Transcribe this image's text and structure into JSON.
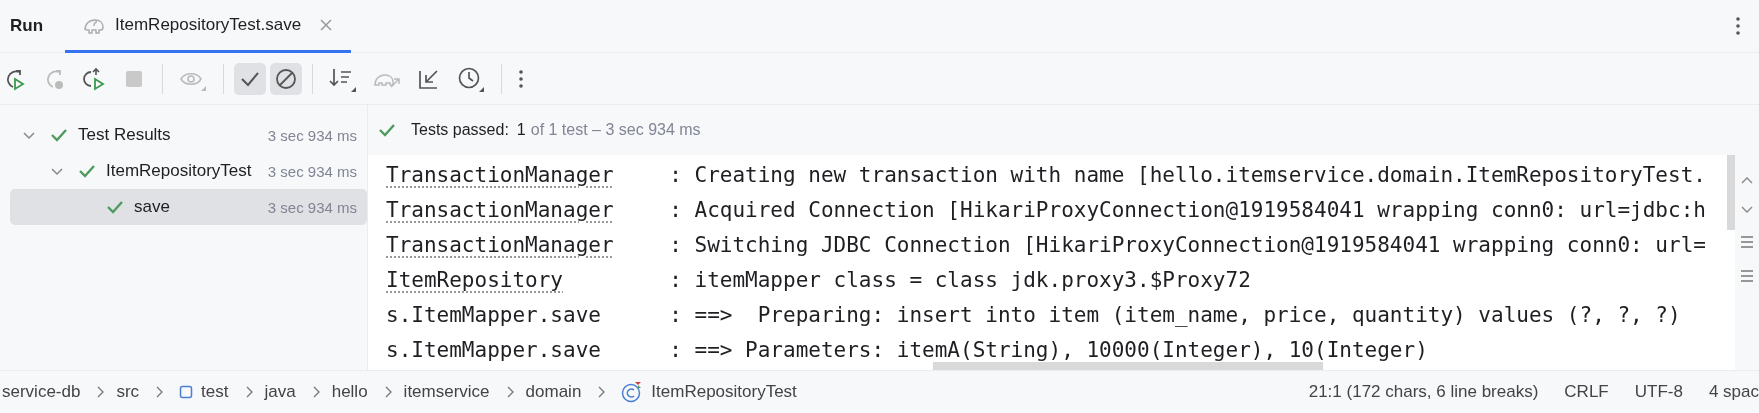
{
  "run_panel": {
    "title": "Run",
    "tabs": [
      {
        "label": "ItemRepositoryTest.save",
        "selected": true
      }
    ]
  },
  "toolbar": {
    "toggles": [
      {
        "selected": true
      },
      {
        "selected": true
      }
    ]
  },
  "test_tree": [
    {
      "label": "Test Results",
      "time": "3 sec 934 ms",
      "passed": true,
      "expanded": true,
      "selected": false,
      "children": [
        {
          "label": "ItemRepositoryTest",
          "time": "3 sec 934 ms",
          "passed": true,
          "expanded": true,
          "selected": false,
          "children": [
            {
              "label": "save",
              "time": "3 sec 934 ms",
              "passed": true,
              "selected": true
            }
          ]
        }
      ]
    }
  ],
  "summary": {
    "passed": true,
    "status": "Tests passed:",
    "count": "1",
    "detail": "of 1 test – 3 sec 934 ms"
  },
  "console": [
    {
      "logger": "TransactionManager",
      "linked": true,
      "message": ": Creating new transaction with name [hello.itemservice.domain.ItemRepositoryTest."
    },
    {
      "logger": "TransactionManager",
      "linked": true,
      "message": ": Acquired Connection [HikariProxyConnection@1919584041 wrapping conn0: url=jdbc:h"
    },
    {
      "logger": "TransactionManager",
      "linked": true,
      "message": ": Switching JDBC Connection [HikariProxyConnection@1919584041 wrapping conn0: url="
    },
    {
      "logger": "ItemRepository",
      "linked": true,
      "message": ": itemMapper class = class jdk.proxy3.$Proxy72"
    },
    {
      "logger": "s.ItemMapper.save",
      "linked": false,
      "message": ": ==>  Preparing: insert into item (item_name, price, quantity) values (?, ?, ?)"
    },
    {
      "logger": "s.ItemMapper.save",
      "linked": false,
      "message": ": ==> Parameters: itemA(String), 10000(Integer), 10(Integer)"
    }
  ],
  "status_bar": {
    "breadcrumbs": [
      {
        "label": "service-db",
        "kind": "plain"
      },
      {
        "label": "src",
        "kind": "plain"
      },
      {
        "label": "test",
        "kind": "test-folder"
      },
      {
        "label": "java",
        "kind": "plain"
      },
      {
        "label": "hello",
        "kind": "plain"
      },
      {
        "label": "itemservice",
        "kind": "plain"
      },
      {
        "label": "domain",
        "kind": "plain"
      },
      {
        "label": "ItemRepositoryTest",
        "kind": "class"
      }
    ],
    "position": "21:1 (172 chars, 6 line breaks)",
    "line_separator": "CRLF",
    "encoding": "UTF-8",
    "indent": "4 spac"
  }
}
